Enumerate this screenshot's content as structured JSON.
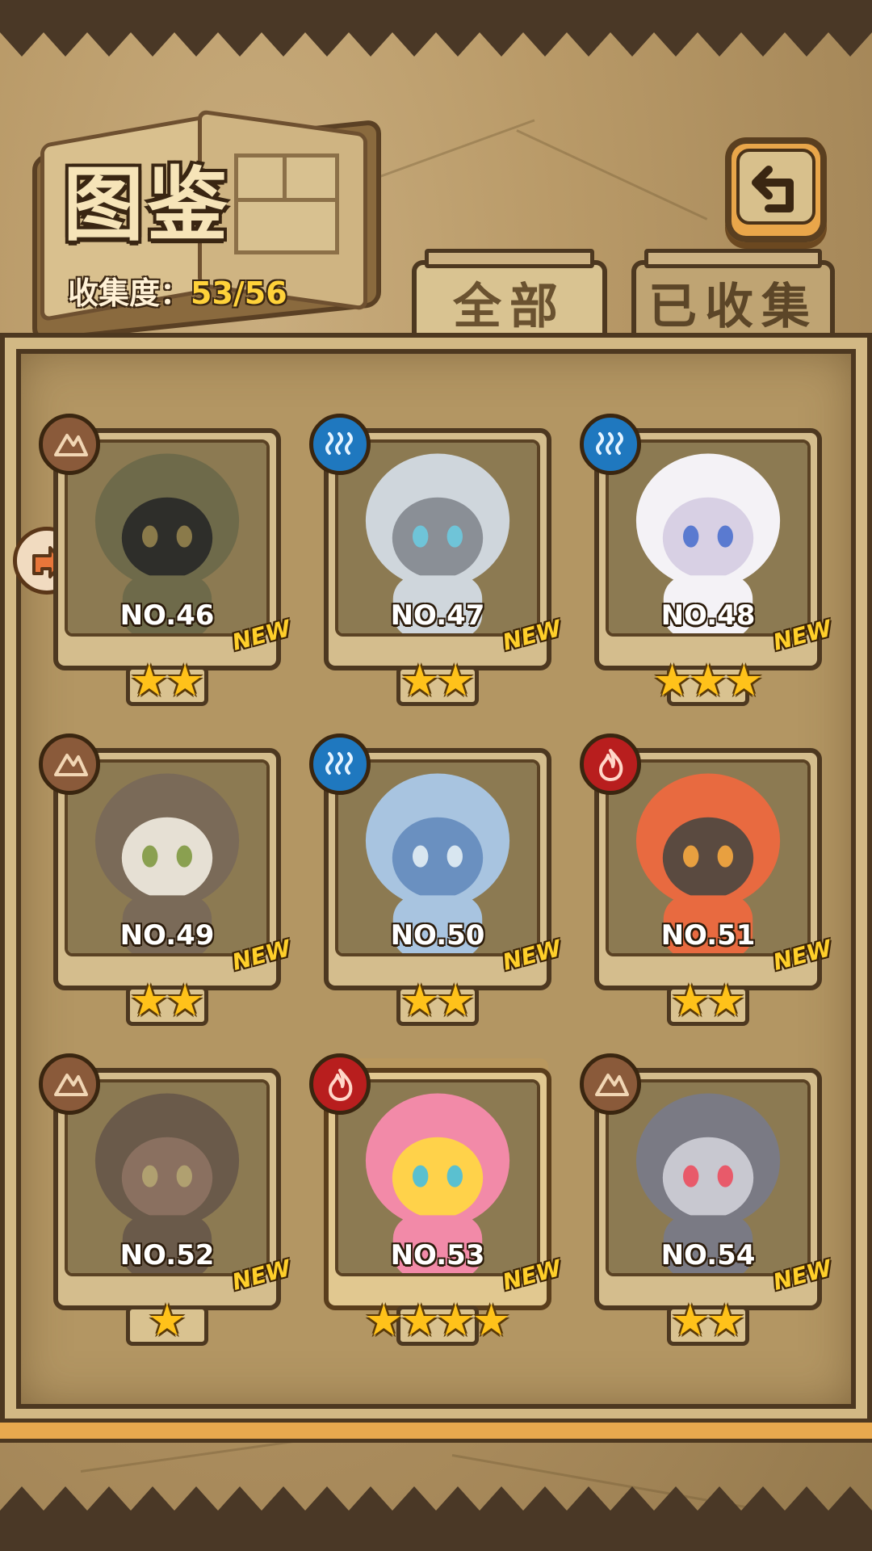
{
  "header": {
    "title": "图鉴",
    "collection_label": "收集度：",
    "collection_value": "53/56"
  },
  "tabs": [
    {
      "label": "全部",
      "active": true
    },
    {
      "label": "已收集",
      "active": false
    }
  ],
  "colors": {
    "earth": "#8a5a3a",
    "water": "#1f78bf",
    "fire": "#b81e1e",
    "star": "#ffc21a",
    "new_badge": "#ffcf2a"
  },
  "cards": [
    {
      "no": "NO.46",
      "new": "NEW",
      "stars": 2,
      "element": "earth",
      "element_icon": "earth-element-icon"
    },
    {
      "no": "NO.47",
      "new": "NEW",
      "stars": 2,
      "element": "water",
      "element_icon": "water-element-icon"
    },
    {
      "no": "NO.48",
      "new": "NEW",
      "stars": 3,
      "element": "water",
      "element_icon": "water-element-icon"
    },
    {
      "no": "NO.49",
      "new": "NEW",
      "stars": 2,
      "element": "earth",
      "element_icon": "earth-element-icon"
    },
    {
      "no": "NO.50",
      "new": "NEW",
      "stars": 2,
      "element": "water",
      "element_icon": "water-element-icon"
    },
    {
      "no": "NO.51",
      "new": "NEW",
      "stars": 2,
      "element": "fire",
      "element_icon": "fire-element-icon"
    },
    {
      "no": "NO.52",
      "new": "NEW",
      "stars": 1,
      "element": "earth",
      "element_icon": "earth-element-icon"
    },
    {
      "no": "NO.53",
      "new": "NEW",
      "stars": 4,
      "element": "fire",
      "element_icon": "fire-element-icon"
    },
    {
      "no": "NO.54",
      "new": "NEW",
      "stars": 2,
      "element": "earth",
      "element_icon": "earth-element-icon"
    }
  ],
  "icons": {
    "back": "return-arrow-icon",
    "side_badge": "side-arrow-badge-icon"
  }
}
